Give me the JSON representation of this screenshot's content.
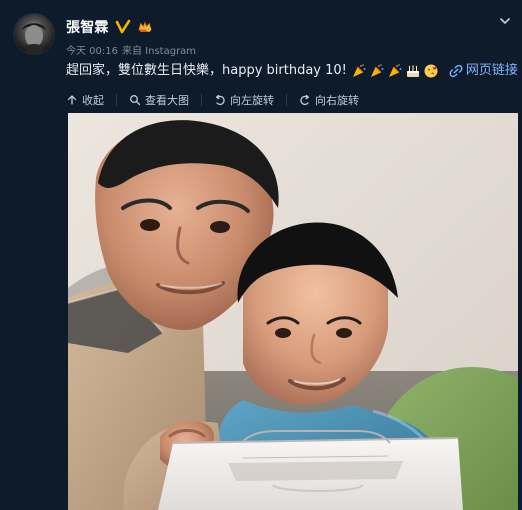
{
  "post": {
    "username": "張智霖",
    "meta": {
      "time": "今天 00:16",
      "source": "来自 Instagram"
    },
    "text": "趕回家，雙位數生日快樂，happy birthday 10!",
    "emojis": [
      "party-popper-emoji",
      "party-popper-emoji",
      "party-popper-emoji",
      "birthday-cake-emoji",
      "kiss-face-emoji"
    ],
    "link_label": "网页链接"
  },
  "toolbar": {
    "items": [
      {
        "label": "收起",
        "icon": "collapse-icon"
      },
      {
        "label": "查看大图",
        "icon": "magnifier-icon"
      },
      {
        "label": "向左旋转",
        "icon": "rotate-left-icon"
      },
      {
        "label": "向右旋转",
        "icon": "rotate-right-icon"
      }
    ]
  },
  "colors": {
    "background": "#0e1b2b",
    "username": "#ffffff",
    "meta": "#7f8b99",
    "link": "#7fb2ff",
    "badge_v": "#f4b400"
  }
}
